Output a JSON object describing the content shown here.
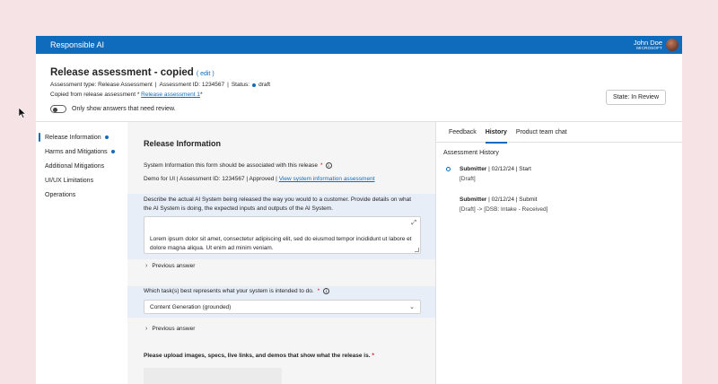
{
  "app": {
    "brand": "Responsible AI"
  },
  "user": {
    "name": "John Doe",
    "org": "MICROSOFT"
  },
  "header": {
    "title": "Release assessment - copied",
    "edit": "( edit )",
    "type_label": "Assessment type: Release Assessment",
    "id_label": "Assessment ID: 1234567",
    "status_label": "Status:",
    "status_value": "draft",
    "copied_prefix": "Copied from release assessment *",
    "copied_link": "Release assessment 1",
    "copied_suffix": "*",
    "toggle_label": "Only show answers that need review.",
    "state_button": "State: In Review"
  },
  "sidebar": {
    "items": [
      {
        "label": "Release Information",
        "dot": true,
        "active": true
      },
      {
        "label": "Harms and Mitigations",
        "dot": true,
        "active": false
      },
      {
        "label": "Additional Mitigations",
        "dot": false,
        "active": false
      },
      {
        "label": "UI/UX Limitations",
        "dot": false,
        "active": false
      },
      {
        "label": "Operations",
        "dot": false,
        "active": false
      }
    ]
  },
  "main": {
    "section_title": "Release Information",
    "q1": "System Information this form should be associated with this release",
    "q1_answer": "Demo for UI | Assessment ID: 1234567 | Approved |",
    "q1_link": "View system information assessment",
    "q2": "Describe the actual AI System being released the way you would to a customer. Provide details on what the AI System is doing, the expected inputs and outputs of the AI System.",
    "q2_value": "Lorem ipsum dolor sit amet, consectetur adipiscing elit, sed do eiusmod tempor incididunt ut labore et dolore magna aliqua. Ut enim ad minim veniam.",
    "previous_answer": "Previous answer",
    "q3": "Which task(s) best represents what your system is intended to do.",
    "q3_value": "Content Generation (grounded)",
    "q4": "Please upload images, specs, live links, and demos that show what the release is.",
    "required_mark": "*"
  },
  "panel": {
    "tabs": [
      "Feedback",
      "History",
      "Product team chat"
    ],
    "active_tab": "History",
    "history_title": "Assessment History",
    "entries": [
      {
        "who": "Submitter",
        "meta": "| 02/12/24 | Start",
        "detail": "[Draft]"
      },
      {
        "who": "Submitter",
        "meta": "| 02/12/24 | Submit",
        "detail": "[Draft] -> [DSB: Intake - Received]"
      }
    ]
  },
  "colors": {
    "brand_blue": "#0f6cbd",
    "band": "#e8eef8",
    "background": "#f6e3e5"
  }
}
